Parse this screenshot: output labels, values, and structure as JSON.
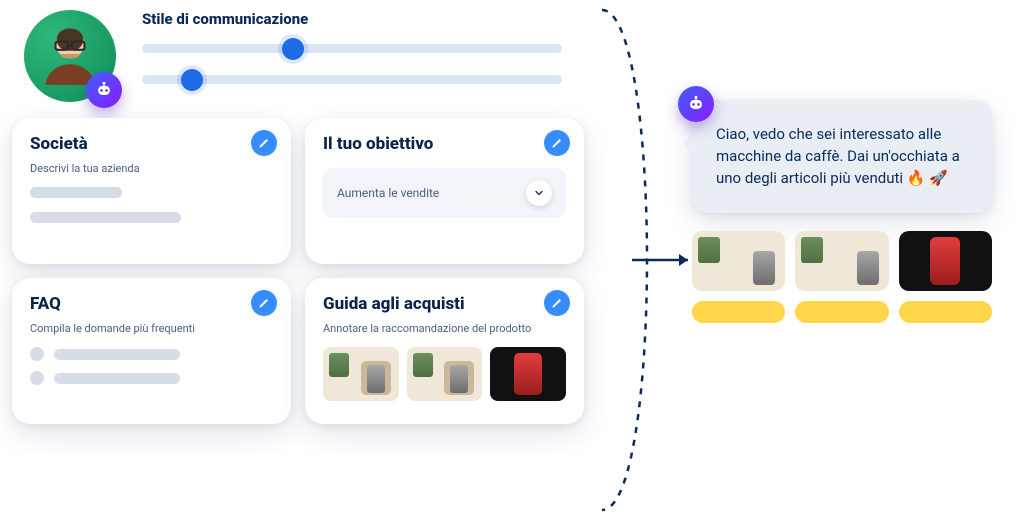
{
  "header": {
    "title": "Stile di communicazione"
  },
  "cards": {
    "company": {
      "title": "Società",
      "subtitle": "Descrivi la tua azienda"
    },
    "goal": {
      "title": "Il tuo obiettivo",
      "select_value": "Aumenta le vendite"
    },
    "faq": {
      "title": "FAQ",
      "subtitle": "Compila le domande più frequenti"
    },
    "guide": {
      "title": "Guida agli acquisti",
      "subtitle": "Annotare la raccomandazione del prodotto"
    }
  },
  "preview": {
    "message": "Ciao, vedo che sei interessato alle macchine da caffè. Dai un'occhiata a uno degli articoli più venduti 🔥 🚀"
  }
}
